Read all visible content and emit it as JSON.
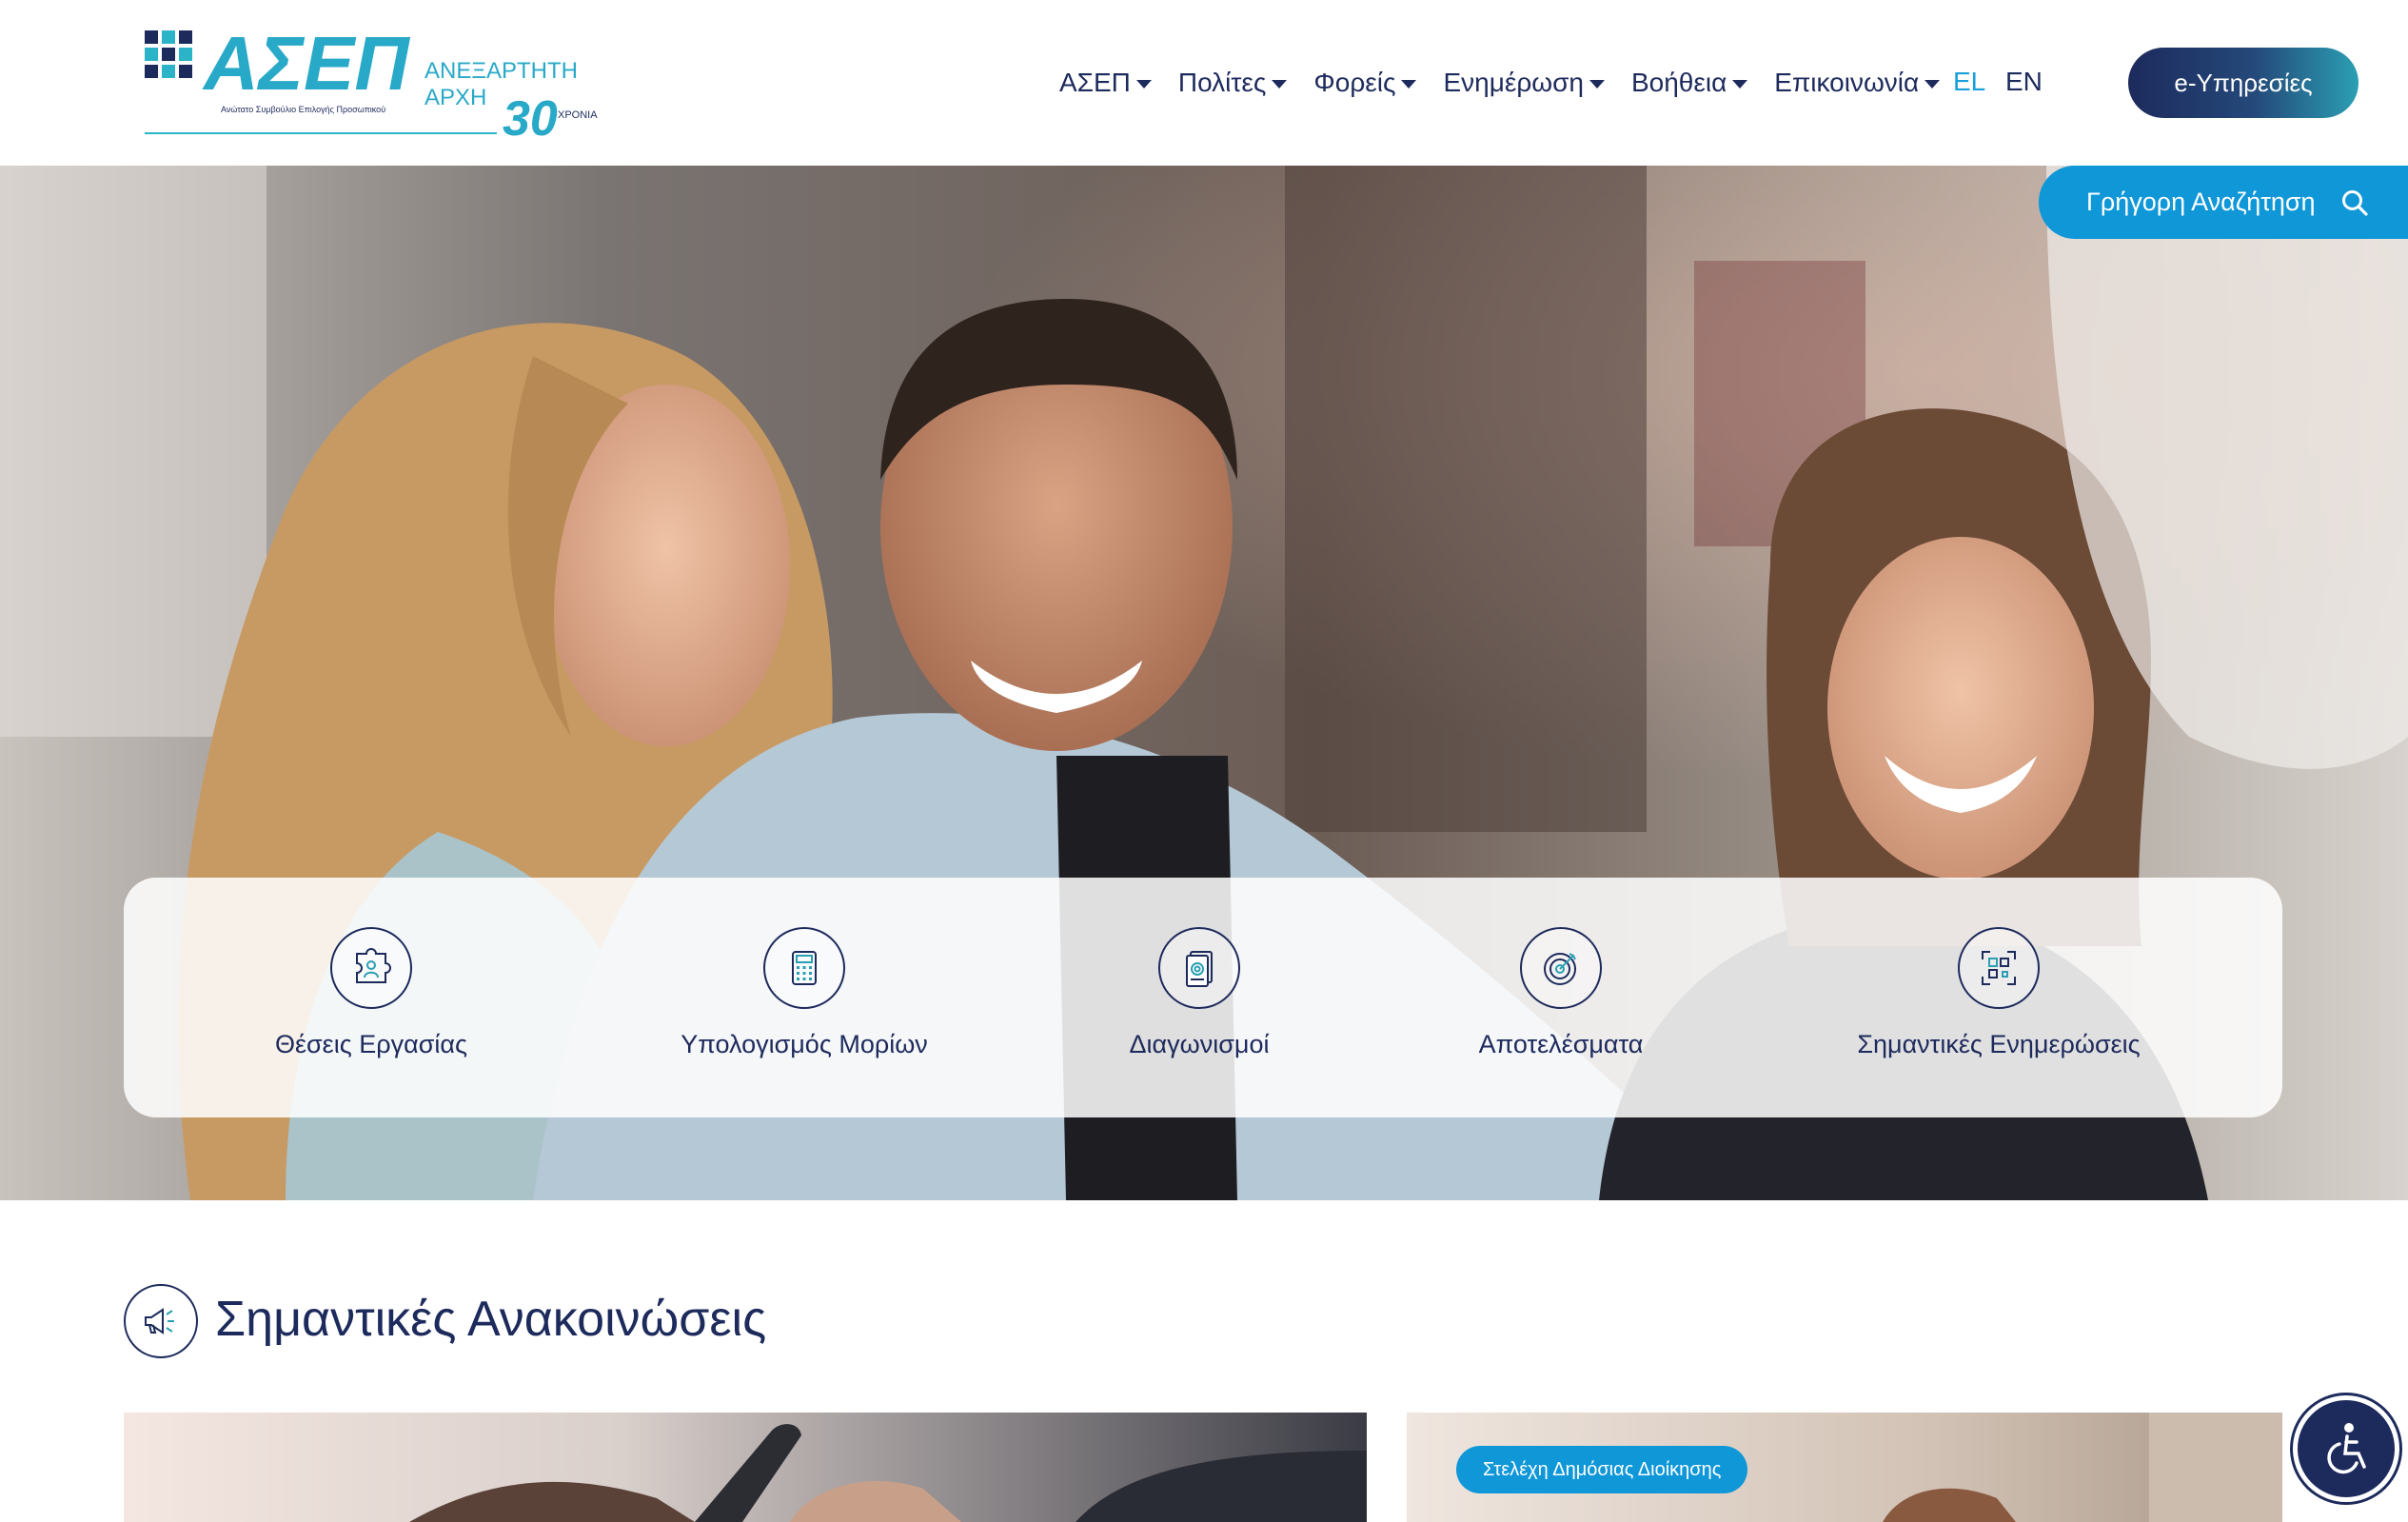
{
  "header": {
    "logo": {
      "wordmark": "ΑΣΕΠ",
      "tagline": "Ανώτατο Συμβούλιο Επιλογής Προσωπικού",
      "authority_line1": "ΑΝΕΞΑΡΤΗΤΗ",
      "authority_line2": "ΑΡΧΗ",
      "anniversary_number": "30",
      "anniversary_word": "ΧΡΟΝΙΑ"
    },
    "nav": [
      {
        "label": "ΑΣΕΠ"
      },
      {
        "label": "Πολίτες"
      },
      {
        "label": "Φορείς"
      },
      {
        "label": "Ενημέρωση"
      },
      {
        "label": "Βοήθεια"
      },
      {
        "label": "Επικοινωνία"
      }
    ],
    "languages": {
      "active": "EL",
      "other": "EN"
    },
    "eservices_label": "e-Υπηρεσίες"
  },
  "hero": {
    "quick_search_label": "Γρήγορη Αναζήτηση",
    "tiles": [
      {
        "label": "Θέσεις Εργασίας",
        "icon": "puzzle-person-icon"
      },
      {
        "label": "Υπολογισμός Μορίων",
        "icon": "calculator-icon"
      },
      {
        "label": "Διαγωνισμοί",
        "icon": "documents-seal-icon"
      },
      {
        "label": "Αποτελέσματα",
        "icon": "target-icon"
      },
      {
        "label": "Σημαντικές Ενημερώσεις",
        "icon": "qr-scan-icon"
      }
    ]
  },
  "announcements": {
    "title": "Σημαντικές Ανακοινώσεις",
    "cards": [
      {
        "badge": ""
      },
      {
        "badge": "Στελέχη Δημόσιας Διοίκησης"
      }
    ]
  },
  "colors": {
    "navy": "#1d2a5c",
    "accent_blue": "#0f97d8",
    "teal": "#2b9fb3"
  }
}
